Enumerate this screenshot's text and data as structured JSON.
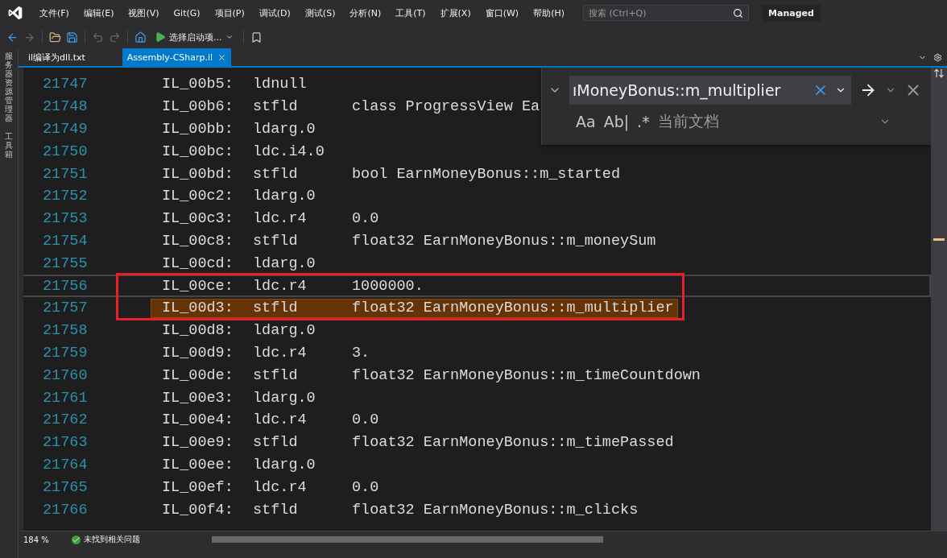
{
  "menu": {
    "items": [
      "文件(F)",
      "编辑(E)",
      "视图(V)",
      "Git(G)",
      "项目(P)",
      "调试(D)",
      "测试(S)",
      "分析(N)",
      "工具(T)",
      "扩展(X)",
      "窗口(W)",
      "帮助(H)"
    ],
    "search": {
      "placeholder": "搜索 (Ctrl+Q)"
    },
    "badge": "Managed"
  },
  "toolbar": {
    "startup": "选择启动项..."
  },
  "side_panel": [
    "服务器资源管理器",
    "工具箱"
  ],
  "tabs": [
    {
      "label": "il编译为dll.txt",
      "selected": false
    },
    {
      "label": "Assembly-CSharp.il",
      "selected": true
    }
  ],
  "code": [
    {
      "line": "21747",
      "label": "IL_00b5:",
      "opcode": "ldnull",
      "selected": false,
      "current": false
    },
    {
      "line": "21748",
      "label": "IL_00b6:",
      "opcode": "stfld",
      "operand": "class ProgressView Ea",
      "selected": false,
      "current": false
    },
    {
      "line": "21749",
      "label": "IL_00bb:",
      "opcode": "ldarg.0",
      "selected": false,
      "current": false
    },
    {
      "line": "21750",
      "label": "IL_00bc:",
      "opcode": "ldc.i4.0",
      "selected": false,
      "current": false
    },
    {
      "line": "21751",
      "label": "IL_00bd:",
      "opcode": "stfld",
      "operand": "bool EarnMoneyBonus::m_started",
      "selected": false,
      "current": false
    },
    {
      "line": "21752",
      "label": "IL_00c2:",
      "opcode": "ldarg.0",
      "selected": false,
      "current": false
    },
    {
      "line": "21753",
      "label": "IL_00c3:",
      "opcode": "ldc.r4",
      "operand": "0.0",
      "selected": false,
      "current": false
    },
    {
      "line": "21754",
      "label": "IL_00c8:",
      "opcode": "stfld",
      "operand": "float32 EarnMoneyBonus::m_moneySum",
      "selected": false,
      "current": false
    },
    {
      "line": "21755",
      "label": "IL_00cd:",
      "opcode": "ldarg.0",
      "selected": false,
      "current": false
    },
    {
      "line": "21756",
      "label": "IL_00ce:",
      "opcode": "ldc.r4",
      "operand": "1000000.",
      "selected": false,
      "current": true
    },
    {
      "line": "21757",
      "label": "IL_00d3:",
      "opcode": "stfld",
      "operand": "float32 EarnMoneyBonus::m_multiplier",
      "selected": true,
      "current": false
    },
    {
      "line": "21758",
      "label": "IL_00d8:",
      "opcode": "ldarg.0",
      "selected": false,
      "current": false
    },
    {
      "line": "21759",
      "label": "IL_00d9:",
      "opcode": "ldc.r4",
      "operand": "3.",
      "selected": false,
      "current": false
    },
    {
      "line": "21760",
      "label": "IL_00de:",
      "opcode": "stfld",
      "operand": "float32 EarnMoneyBonus::m_timeCountdown",
      "selected": false,
      "current": false
    },
    {
      "line": "21761",
      "label": "IL_00e3:",
      "opcode": "ldarg.0",
      "selected": false,
      "current": false
    },
    {
      "line": "21762",
      "label": "IL_00e4:",
      "opcode": "ldc.r4",
      "operand": "0.0",
      "selected": false,
      "current": false
    },
    {
      "line": "21763",
      "label": "IL_00e9:",
      "opcode": "stfld",
      "operand": "float32 EarnMoneyBonus::m_timePassed",
      "selected": false,
      "current": false
    },
    {
      "line": "21764",
      "label": "IL_00ee:",
      "opcode": "ldarg.0",
      "selected": false,
      "current": false
    },
    {
      "line": "21765",
      "label": "IL_00ef:",
      "opcode": "ldc.r4",
      "operand": "0.0",
      "selected": false,
      "current": false
    },
    {
      "line": "21766",
      "label": "IL_00f4:",
      "opcode": "stfld",
      "operand": "float32 EarnMoneyBonus::m_clicks",
      "selected": false,
      "current": false
    }
  ],
  "find": {
    "value": "ıMoneyBonus::m_multiplier",
    "options": [
      "Aa",
      "Ab|",
      ".*"
    ],
    "scope": "当前文档"
  },
  "status": {
    "zoom": "184 %",
    "issues": "未找到相关问题"
  }
}
